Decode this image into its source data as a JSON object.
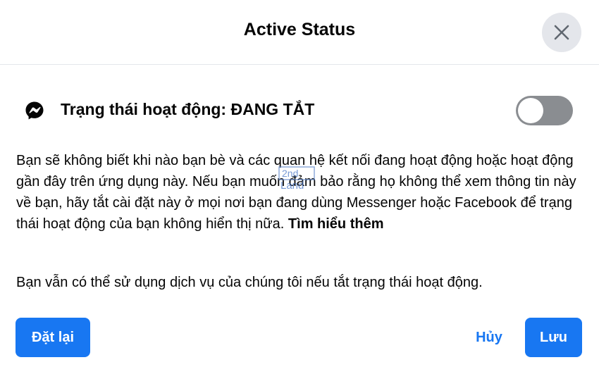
{
  "header": {
    "title": "Active Status"
  },
  "status_row": {
    "icon": "messenger-icon",
    "label": "Trạng thái hoạt động: ĐANG TẮT",
    "toggle_on": false
  },
  "description": {
    "text": "Bạn sẽ không biết khi nào bạn bè và các quan hệ kết nối đang hoạt động hoặc hoạt động gần đây trên ứng dụng này. Nếu bạn muốn đảm bảo rằng họ không thể xem thông tin này về bạn, hãy tắt cài đặt này ở mọi nơi bạn đang dùng Messenger hoặc Facebook để trạng thái hoạt động của bạn không hiển thị nữa. ",
    "learn_more": "Tìm hiểu thêm"
  },
  "note": "Bạn vẫn có thể sử dụng dịch vụ của chúng tôi nếu tắt trạng thái hoạt động.",
  "watermark": "2nd Land",
  "buttons": {
    "reset": "Đặt lại",
    "cancel": "Hủy",
    "save": "Lưu"
  },
  "colors": {
    "accent": "#1877f2",
    "toggle_off": "#8a8d91",
    "close_bg": "#e4e6eb"
  }
}
